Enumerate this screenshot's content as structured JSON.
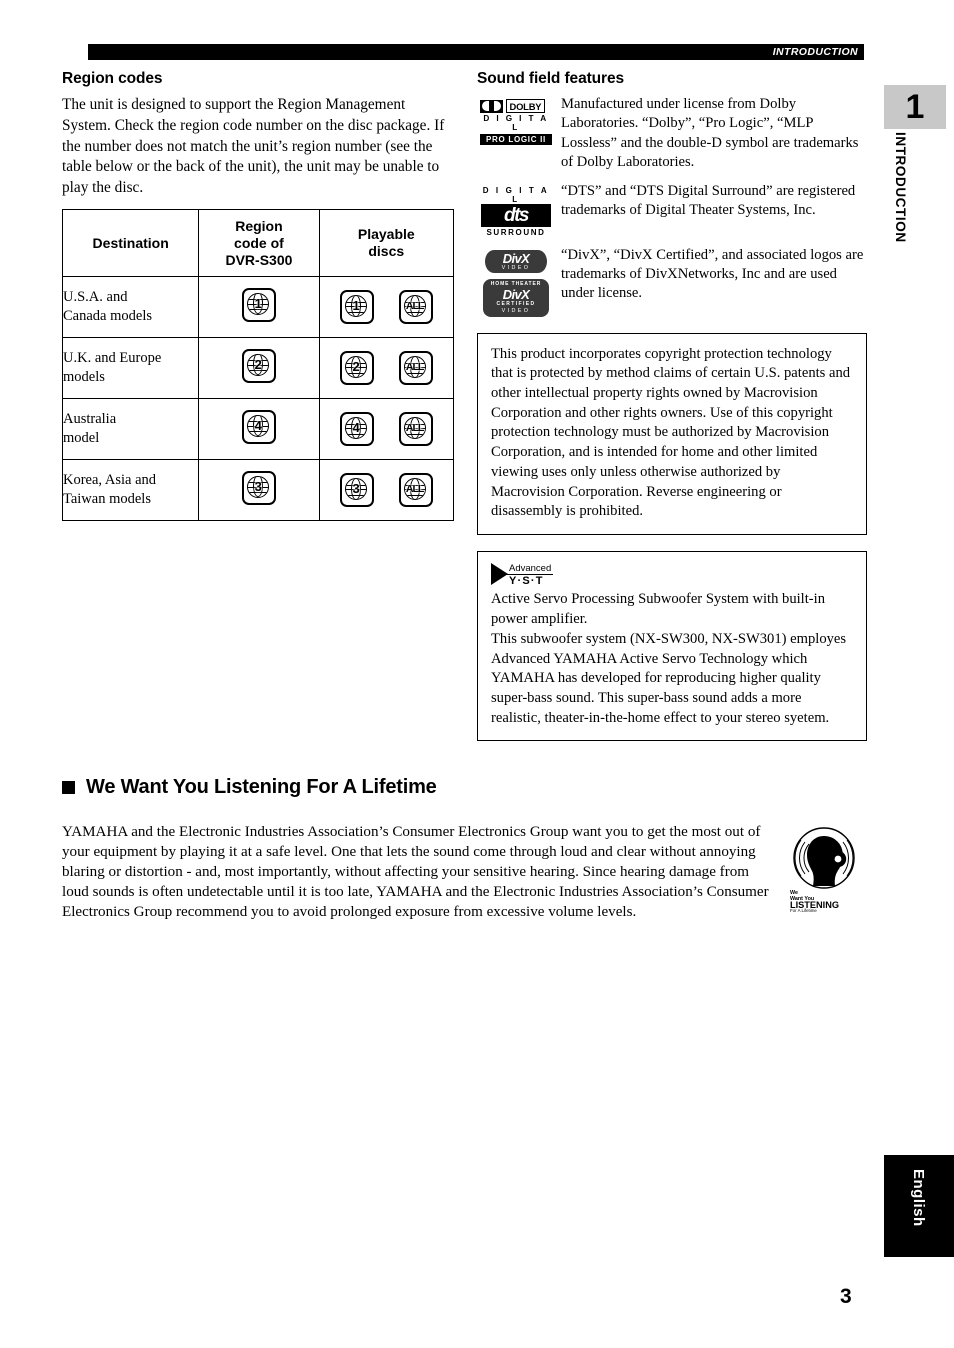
{
  "header": {
    "running_head": "INTRODUCTION"
  },
  "sidebar": {
    "chapter_number": "1",
    "chapter_label": "INTRODUCTION",
    "language_tab": "English",
    "page_number": "3"
  },
  "left_column": {
    "region_codes": {
      "title": "Region codes",
      "paragraph": "The unit is designed to support the Region Management System. Check the region code number on the disc package. If the number does not match the unit’s region number (see the table below or the back of the unit), the unit may be unable to play the disc."
    },
    "region_table": {
      "headers": [
        "Destination",
        "Region code of DVR-S300",
        "Playable discs"
      ],
      "header_lines": {
        "destination": "Destination",
        "region_code_l1": "Region",
        "region_code_l2": "code of",
        "region_code_l3": "DVR-S300",
        "playable_l1": "Playable",
        "playable_l2": "discs"
      },
      "rows": [
        {
          "destination_l1": "U.S.A. and",
          "destination_l2": "Canada models",
          "region_code": "1",
          "playable": [
            "1",
            "ALL"
          ]
        },
        {
          "destination_l1": "U.K. and Europe",
          "destination_l2": "models",
          "region_code": "2",
          "playable": [
            "2",
            "ALL"
          ]
        },
        {
          "destination_l1": "Australia",
          "destination_l2": "model",
          "region_code": "4",
          "playable": [
            "4",
            "ALL"
          ]
        },
        {
          "destination_l1": "Korea, Asia and",
          "destination_l2": "Taiwan models",
          "region_code": "3",
          "playable": [
            "3",
            "ALL"
          ]
        }
      ]
    }
  },
  "right_column": {
    "sound_field": {
      "title": "Sound field features",
      "entries": [
        {
          "logo": "dolby-digital-pro-logic-ii-logo",
          "logo_text": {
            "word": "DOLBY",
            "digital": "D I G I T A L",
            "prologic": "PRO LOGIC II"
          },
          "text": "Manufactured under license from Dolby Laboratories. “Dolby”, “Pro Logic”, “MLP Lossless” and the double-D symbol are trademarks of Dolby Laboratories."
        },
        {
          "logo": "dts-digital-surround-logo",
          "logo_text": {
            "top": "D I G I T A L",
            "glyph": "dts",
            "bottom": "SURROUND"
          },
          "text": "“DTS” and “DTS Digital Surround” are registered trademarks of Digital Theater Systems, Inc."
        },
        {
          "logo": "divx-video-logo",
          "logo_text": {
            "word": "DivX",
            "sub": "VIDEO",
            "cert_top": "HOME THEATER",
            "cert_word": "DivX",
            "cert_mid": "CERTIFIED",
            "cert_sub": "VIDEO"
          },
          "text": "“DivX”, “DivX Certified”, and associated logos are trademarks of DivXNetworks, Inc and are used under license."
        }
      ]
    },
    "macrovision_note": "This product incorporates copyright protection technology that is protected by method claims of certain U.S. patents and other intellectual property rights owned by Macrovision Corporation and other rights owners. Use of this copyright protection technology must be authorized by Macrovision Corporation, and is intended for home and other limited viewing uses only unless otherwise authorized by Macrovision Corporation. Reverse engineering or disassembly is prohibited.",
    "yst_note": {
      "logo": "advanced-yst-logo",
      "logo_advanced": "Advanced",
      "logo_word": "Y·S·T",
      "text": "Active Servo Processing Subwoofer System with built-in power amplifier.\nThis subwoofer system (NX-SW300, NX-SW301) employes Advanced YAMAHA Active Servo Technology which YAMAHA has developed for reproducing higher quality super-bass sound. This super-bass sound adds a more realistic, theater-in-the-home effect to your stereo syetem."
    }
  },
  "lifetime": {
    "heading": "We Want You Listening For A Lifetime",
    "paragraph": "YAMAHA and the Electronic Industries Association’s Consumer Electronics Group want you to get the most out of your equipment by playing it at a safe level. One that lets the sound come through loud and clear without annoying blaring or distortion - and, most importantly, without affecting your sensitive hearing. Since hearing damage from loud sounds is often undetectable until it is too late, YAMAHA and the Electronic Industries Association’s Consumer Electronics Group recommend you to avoid prolonged exposure from excessive volume levels.",
    "logo": {
      "name": "we-want-you-listening-for-a-lifetime-logo",
      "line1": "We",
      "line2": "Want You",
      "line3": "LISTENING",
      "line4": "For A Lifetime"
    }
  },
  "colors": {
    "ink": "#000000",
    "paper": "#ffffff",
    "chapter_tab_gray": "#c8c8c8",
    "logo_gray": "#3a3a3a"
  }
}
